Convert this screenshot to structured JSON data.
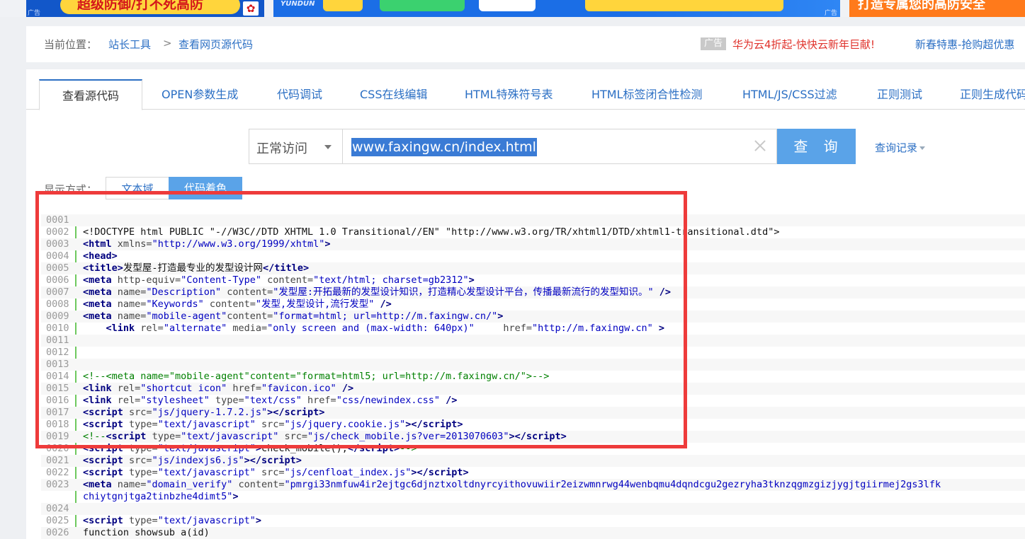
{
  "ads": {
    "ad1": {
      "text": "超级防御/打不死高防",
      "tag": "广告"
    },
    "ad2": {
      "brand": "YUNDUN",
      "tag": "广告"
    },
    "ad3": {
      "text": "打造专属您的高防安全"
    }
  },
  "breadcrumb": {
    "label": "当前位置：",
    "items": [
      "站长工具",
      "查看网页源代码"
    ],
    "separator": ">"
  },
  "promo": {
    "badge": "广告",
    "link1": "华为云4折起-快快云新年巨献!",
    "link2": "新春特惠-抢购超优惠"
  },
  "tabs": [
    {
      "label": "查看源代码",
      "active": true
    },
    {
      "label": "OPEN参数生成"
    },
    {
      "label": "代码调试"
    },
    {
      "label": "CSS在线编辑"
    },
    {
      "label": "HTML特殊符号表"
    },
    {
      "label": "HTML标签闭合性检测"
    },
    {
      "label": "HTML/JS/CSS过滤"
    },
    {
      "label": "正则测试"
    },
    {
      "label": "正则生成代码"
    }
  ],
  "search": {
    "mode": "正常访问",
    "url": "www.faxingw.cn/index.html",
    "button": "查 询",
    "history": "查询记录"
  },
  "display": {
    "label": "显示方式：",
    "text_mode": "文本域",
    "color_mode": "代码着色"
  },
  "code_lines": [
    {
      "n": "0001",
      "html": ""
    },
    {
      "n": "0002",
      "html": "&lt;!DOCTYPE html PUBLIC \"-//W3C//DTD XHTML 1.0 Transitional//EN\" \"http://www.w3.org/TR/xhtml1/DTD/xhtml1-transitional.dtd\"&gt;"
    },
    {
      "n": "0003",
      "html": "<span class=\"tg\">&lt;html</span> <span class=\"at\">xmlns=</span><span class=\"st\">\"http://www.w3.org/1999/xhtml\"</span><span class=\"tg\">&gt;</span>"
    },
    {
      "n": "0004",
      "html": "<span class=\"tg\">&lt;head&gt;</span>"
    },
    {
      "n": "0005",
      "html": "<span class=\"tg\">&lt;title&gt;</span>发型屋-打造最专业的发型设计网<span class=\"tg\">&lt;/title&gt;</span>"
    },
    {
      "n": "0006",
      "html": "<span class=\"tg\">&lt;meta</span> <span class=\"at\">http-equiv=</span><span class=\"st\">\"Content-Type\"</span> <span class=\"at\">content=</span><span class=\"st\">\"text/html; charset=gb2312\"</span><span class=\"tg\">&gt;</span>"
    },
    {
      "n": "0007",
      "html": "<span class=\"tg\">&lt;meta</span> <span class=\"at\">name=</span><span class=\"st\">\"Description\"</span> <span class=\"at\">content=</span><span class=\"st\">\"发型屋:开拓最新的发型设计知识，打造精心发型设计平台，传播最新流行的发型知识。\"</span> <span class=\"tg\">/&gt;</span>"
    },
    {
      "n": "0008",
      "html": "<span class=\"tg\">&lt;meta</span> <span class=\"at\">name=</span><span class=\"st\">\"Keywords\"</span> <span class=\"at\">content=</span><span class=\"st\">\"发型,发型设计,流行发型\"</span> <span class=\"tg\">/&gt;</span>"
    },
    {
      "n": "0009",
      "html": "<span class=\"tg\">&lt;meta</span> <span class=\"at\">name=</span><span class=\"st\">\"mobile-agent\"</span><span class=\"at\">content=</span><span class=\"st\">\"format=html; url=http://m.faxingw.cn/\"</span><span class=\"tg\">&gt;</span>"
    },
    {
      "n": "0010",
      "html": "    <span class=\"tg\">&lt;link</span> <span class=\"at\">rel=</span><span class=\"st\">\"alternate\"</span> <span class=\"at\">media=</span><span class=\"st\">\"only screen and (max-width: 640px)\"</span>     <span class=\"at\">href=</span><span class=\"st\">\"http://m.faxingw.cn\"</span> <span class=\"tg\">&gt;</span>"
    },
    {
      "n": "0011",
      "html": ""
    },
    {
      "n": "0012",
      "html": ""
    },
    {
      "n": "0013",
      "html": ""
    },
    {
      "n": "0014",
      "html": "<span class=\"cm\">&lt;!--&lt;meta name=\"mobile-agent\"content=\"format=html5; url=http://m.faxingw.cn/\"&gt;--&gt;</span>"
    },
    {
      "n": "0015",
      "html": "<span class=\"tg\">&lt;link</span> <span class=\"at\">rel=</span><span class=\"st\">\"shortcut icon\"</span> <span class=\"at\">href=</span><span class=\"st\">\"favicon.ico\"</span> <span class=\"tg\">/&gt;</span>"
    },
    {
      "n": "0016",
      "html": "<span class=\"tg\">&lt;link</span> <span class=\"at\">rel=</span><span class=\"st\">\"stylesheet\"</span> <span class=\"at\">type=</span><span class=\"st\">\"text/css\"</span> <span class=\"at\">href=</span><span class=\"st\">\"css/newindex.css\"</span> <span class=\"tg\">/&gt;</span>"
    },
    {
      "n": "0017",
      "html": "<span class=\"tg\">&lt;script</span> <span class=\"at\">src=</span><span class=\"st\">\"js/jquery-1.7.2.js\"</span><span class=\"tg\">&gt;&lt;/script&gt;</span>"
    },
    {
      "n": "0018",
      "html": "<span class=\"tg\">&lt;script</span> <span class=\"at\">type=</span><span class=\"st\">\"text/javascript\"</span> <span class=\"at\">src=</span><span class=\"st\">\"js/jquery.cookie.js\"</span><span class=\"tg\">&gt;&lt;/script&gt;</span>"
    },
    {
      "n": "0019",
      "html": "<span class=\"cm\">&lt;!--</span><span class=\"tg\">&lt;script</span> <span class=\"at\">type=</span><span class=\"st\">\"text/javascript\"</span> <span class=\"at\">src=</span><span class=\"st\">\"js/check_mobile.js?ver=2013070603\"</span><span class=\"tg\">&gt;&lt;/script&gt;</span>"
    },
    {
      "n": "0020",
      "html": "<span class=\"tg\">&lt;script</span> <span class=\"at\">type=</span><span class=\"st\">\"text/javascript\"</span><span class=\"tg\">&gt;</span>check_mobile();<span class=\"tg\">&lt;/script&gt;</span><span class=\"cm\">--&gt;</span>"
    },
    {
      "n": "0021",
      "html": "<span class=\"tg\">&lt;script</span> <span class=\"at\">src=</span><span class=\"st\">\"js/indexjs6.js\"</span><span class=\"tg\">&gt;&lt;/script&gt;</span>"
    },
    {
      "n": "0022",
      "html": "<span class=\"tg\">&lt;script</span> <span class=\"at\">type=</span><span class=\"st\">\"text/javascript\"</span> <span class=\"at\">src=</span><span class=\"st\">\"js/cenfloat_index.js\"</span><span class=\"tg\">&gt;&lt;/script&gt;</span>"
    },
    {
      "n": "0023",
      "html": "<span class=\"tg\">&lt;meta</span> <span class=\"at\">name=</span><span class=\"st\">\"domain_verify\"</span> <span class=\"at\">content=</span><span class=\"st\">\"pmrgi33nmfuw4ir2ejtgc6djnztxoltdnyrcyithovuwiir2eizwmnrwg44wenbqmu4dqndcgu2gezryha3tknzqgmzgizjygjtgiirmej2gs3lfk</span>"
    },
    {
      "n": "",
      "html": "<span class=\"st\">chiytgnjtga2tinbzhe4dimt5\"</span><span class=\"tg\">&gt;</span>"
    },
    {
      "n": "0024",
      "html": ""
    },
    {
      "n": "0025",
      "html": "<span class=\"tg\">&lt;script</span> <span class=\"at\">type=</span><span class=\"st\">\"text/javascript\"</span><span class=\"tg\">&gt;</span>"
    },
    {
      "n": "0026",
      "html": "function showsub a(id)"
    }
  ]
}
